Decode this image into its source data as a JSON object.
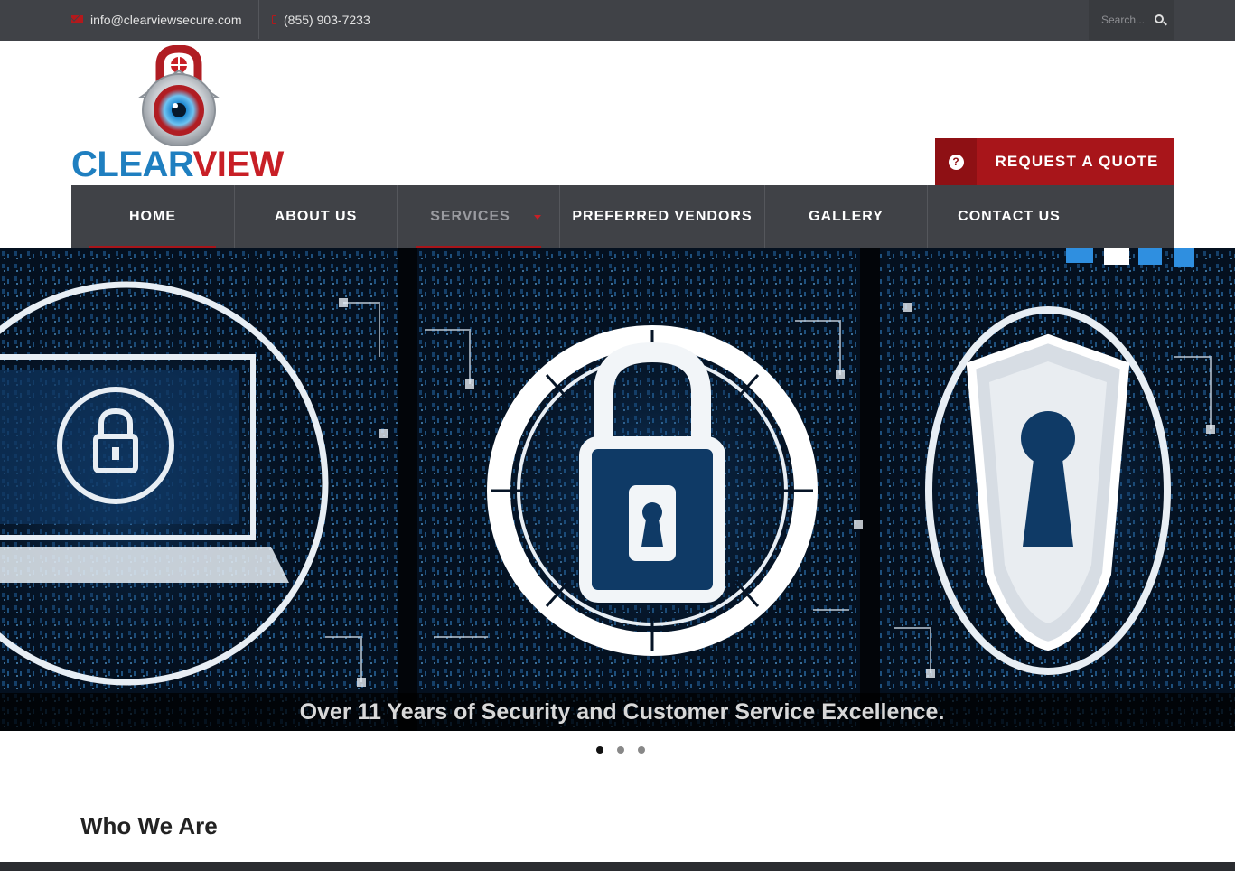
{
  "topbar": {
    "email": "info@clearviewsecure.com",
    "phone": "(855) 903-7233",
    "search_placeholder": "Search..."
  },
  "logo": {
    "word_part1": "CLEAR",
    "word_part2": "VIEW"
  },
  "quote_button": {
    "label": "REQUEST A QUOTE",
    "icon_glyph": "?"
  },
  "nav": {
    "items": [
      {
        "label": "HOME"
      },
      {
        "label": "ABOUT US"
      },
      {
        "label": "SERVICES"
      },
      {
        "label": "PREFERRED VENDORS"
      },
      {
        "label": "GALLERY"
      },
      {
        "label": "CONTACT US"
      }
    ]
  },
  "hero": {
    "caption": "Over 11 Years of Security and Customer Service Excellence."
  },
  "section": {
    "title": "Who We Are"
  },
  "colors": {
    "brand_red": "#a8151a",
    "brand_blue": "#1f7fc0",
    "dark_gray": "#404247"
  }
}
